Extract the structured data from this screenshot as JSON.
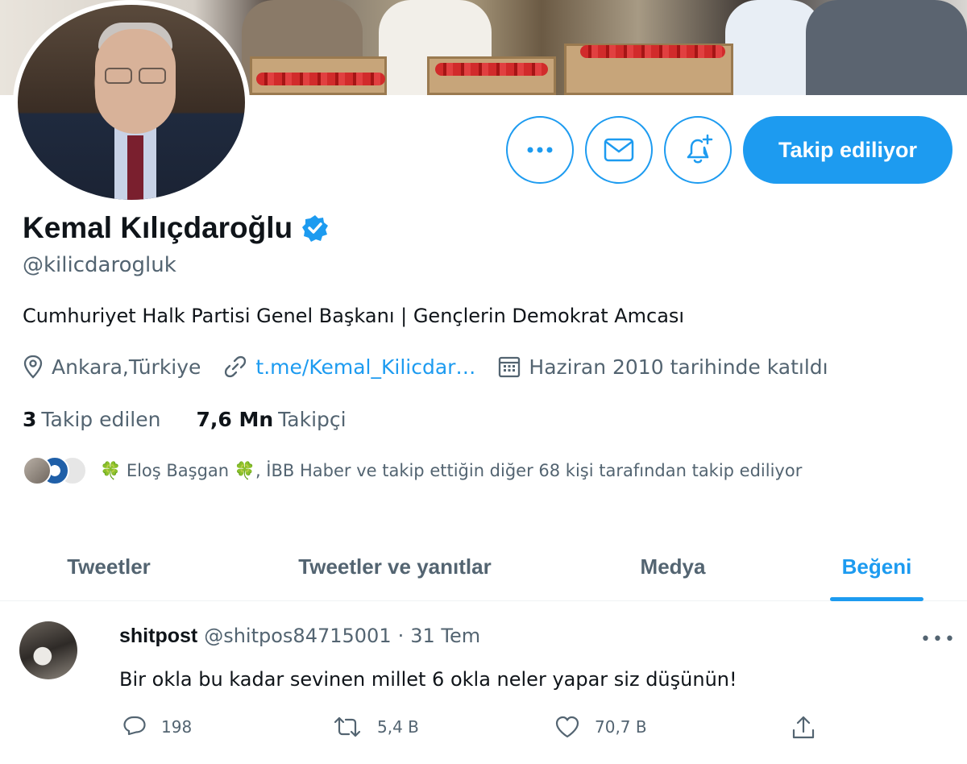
{
  "profile": {
    "name": "Kemal Kılıçdaroğlu",
    "handle": "@kilicdarogluk",
    "bio": "Cumhuriyet Halk Partisi Genel Başkanı | Gençlerin Demokrat Amcası",
    "location": "Ankara,Türkiye",
    "link": "t.me/Kemal_Kilicdar…",
    "joined": "Haziran 2010 tarihinde katıldı",
    "following_count": "3",
    "following_label": "Takip edilen",
    "followers_count": "7,6 Mn",
    "followers_label": "Takipçi",
    "followed_by": "🍀 Eloş Başgan 🍀, İBB Haber ve takip ettiğin diğer 68 kişi tarafından takip ediliyor",
    "verified_icon": "verified-badge-icon"
  },
  "actions": {
    "follow_label": "Takip ediliyor",
    "more_icon": "more-icon",
    "message_icon": "mail-icon",
    "notify_icon": "bell-plus-icon"
  },
  "tabs": [
    {
      "label": "Tweetler",
      "active": false
    },
    {
      "label": "Tweetler ve yanıtlar",
      "active": false
    },
    {
      "label": "Medya",
      "active": false
    },
    {
      "label": "Beğeni",
      "active": true
    }
  ],
  "tweet": {
    "display_name": "shitpost",
    "handle": "@shitpos84715001",
    "separator": "·",
    "date": "31 Tem",
    "text": "Bir okla bu kadar sevinen millet 6 okla neler yapar siz düşünün!",
    "replies": "198",
    "retweets": "5,4 B",
    "likes": "70,7 B",
    "more": "•••"
  },
  "colors": {
    "accent": "#1d9bf0",
    "text": "#0f1419",
    "muted": "#536471"
  }
}
